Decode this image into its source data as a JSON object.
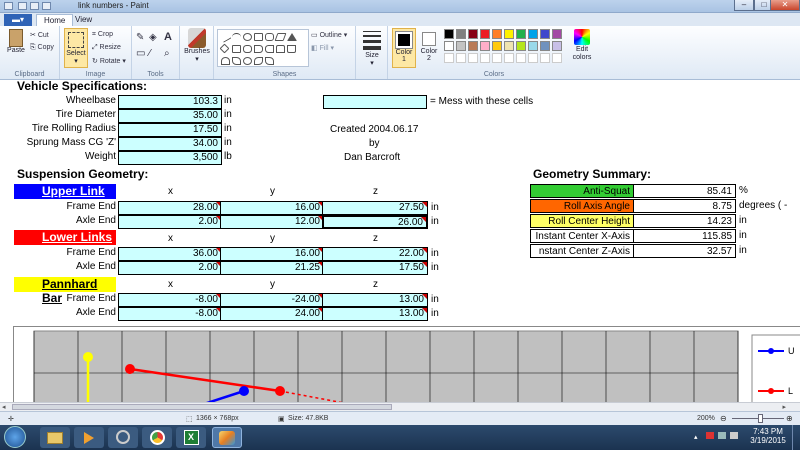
{
  "window": {
    "title": "link numbers - Paint"
  },
  "ribbon": {
    "tabs": {
      "home": "Home",
      "view": "View"
    },
    "clipboard": {
      "paste": "Paste",
      "cut": "Cut",
      "copy": "Copy",
      "group": "Clipboard"
    },
    "image": {
      "select": "Select",
      "crop": "Crop",
      "resize": "Resize",
      "rotate": "Rotate",
      "group": "Image"
    },
    "tools": {
      "group": "Tools",
      "text_tool": "A"
    },
    "brushes": {
      "label": "Brushes"
    },
    "shapes": {
      "outline": "Outline",
      "fill": "Fill",
      "group": "Shapes"
    },
    "size": {
      "label": "Size"
    },
    "colors": {
      "color1": "Color 1",
      "color2": "Color 2",
      "edit": "Edit colors",
      "group": "Colors",
      "palette": [
        "#000000",
        "#7f7f7f",
        "#880015",
        "#ed1c24",
        "#ff7f27",
        "#fff200",
        "#22b14c",
        "#00a2e8",
        "#3f48cc",
        "#a349a4",
        "#ffffff",
        "#c3c3c3",
        "#b97a57",
        "#ffaec9",
        "#ffc90e",
        "#efe4b0",
        "#b5e61d",
        "#99d9ea",
        "#7092be",
        "#c8bfe7",
        "#ffffff",
        "#ffffff",
        "#ffffff",
        "#ffffff",
        "#ffffff",
        "#ffffff",
        "#ffffff",
        "#ffffff",
        "#ffffff",
        "#ffffff"
      ]
    }
  },
  "sheet": {
    "vehicle_title": "Vehicle Specifications:",
    "vehicle": [
      {
        "label": "Wheelbase",
        "value": "103.3",
        "unit": "in"
      },
      {
        "label": "Tire Diameter",
        "value": "35.00",
        "unit": "in"
      },
      {
        "label": "Tire Rolling Radius",
        "value": "17.50",
        "unit": "in"
      },
      {
        "label": "Sprung Mass CG 'Z'",
        "value": "34.00",
        "unit": "in"
      },
      {
        "label": "Weight",
        "value": "3,500",
        "unit": "lb"
      }
    ],
    "mess_note": "= Mess with these cells",
    "created": "Created 2004.06.17",
    "by": "by",
    "author": "Dan Barcroft",
    "suspension_title": "Suspension Geometry:",
    "axes": {
      "x": "x",
      "y": "y",
      "z": "z"
    },
    "upper": {
      "label": "Upper Link",
      "rows": [
        {
          "label": "Frame End",
          "x": "28.00",
          "y": "16.00",
          "z": "27.50",
          "unit": "in"
        },
        {
          "label": "Axle End",
          "x": "2.00",
          "y": "12.00",
          "z": "26.00",
          "unit": "in"
        }
      ]
    },
    "lower": {
      "label": "Lower Links",
      "rows": [
        {
          "label": "Frame End",
          "x": "36.00",
          "y": "16.00",
          "z": "22.00",
          "unit": "in"
        },
        {
          "label": "Axle End",
          "x": "2.00",
          "y": "21.25",
          "z": "17.50",
          "unit": "in"
        }
      ]
    },
    "pannhard": {
      "label": "Pannhard Bar",
      "rows": [
        {
          "label": "Frame End",
          "x": "-8.00",
          "y": "-24.00",
          "z": "13.00",
          "unit": "in"
        },
        {
          "label": "Axle End",
          "x": "-8.00",
          "y": "24.00",
          "z": "13.00",
          "unit": "in"
        }
      ]
    },
    "summary_title": "Geometry Summary:",
    "summary": [
      {
        "label": "Anti-Squat",
        "value": "85.41",
        "unit": "%",
        "color": "#33cc33"
      },
      {
        "label": "Roll Axis Angle",
        "value": "8.75",
        "unit": "degrees ( -",
        "color": "#ff6600"
      },
      {
        "label": "Roll Center Height",
        "value": "14.23",
        "unit": "in",
        "color": "#ffff66"
      },
      {
        "label": "Instant Center X-Axis",
        "value": "115.85",
        "unit": "in",
        "color": "#ffffff"
      },
      {
        "label": "nstant Center Z-Axis",
        "value": "32.57",
        "unit": "in",
        "color": "#ffffff"
      }
    ],
    "legend": [
      "U",
      "L"
    ]
  },
  "status": {
    "dimensions": "1366 × 768px",
    "size": "Size: 47.8KB",
    "zoom": "200%"
  },
  "taskbar": {
    "time": "7:43 PM",
    "date": "3/19/2015"
  }
}
